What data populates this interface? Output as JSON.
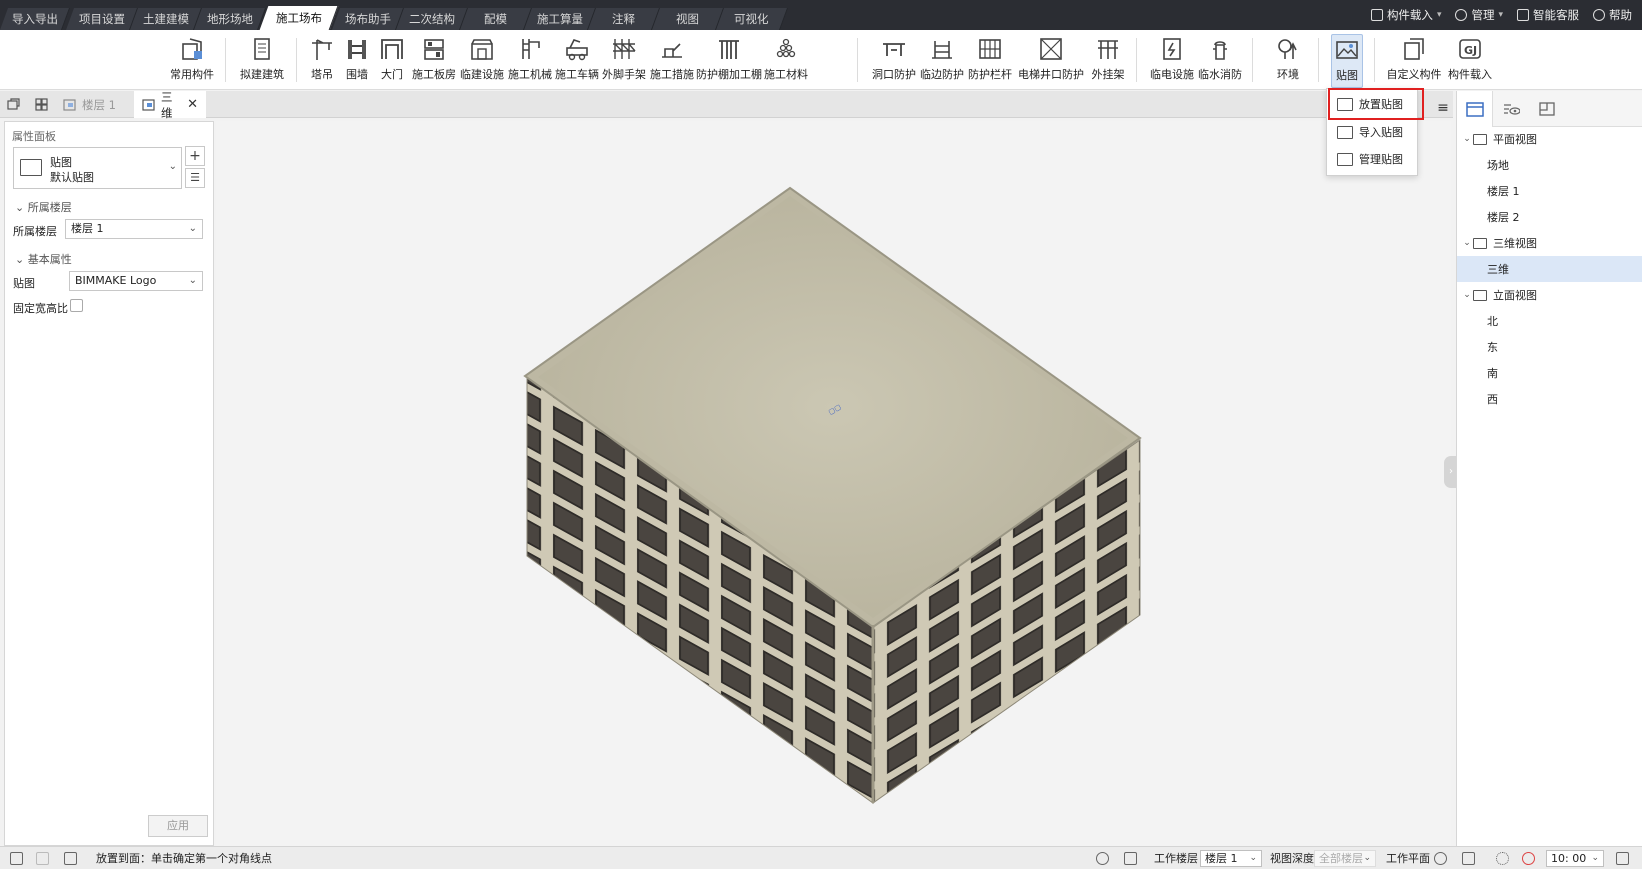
{
  "menu_tabs": [
    {
      "label": "导入导出"
    },
    {
      "label": "项目设置"
    },
    {
      "label": "土建建模"
    },
    {
      "label": "地形场地"
    },
    {
      "label": "施工场布",
      "active": true
    },
    {
      "label": "场布助手"
    },
    {
      "label": "二次结构"
    },
    {
      "label": "配模"
    },
    {
      "label": "施工算量"
    },
    {
      "label": "注释"
    },
    {
      "label": "视图"
    },
    {
      "label": "可视化"
    }
  ],
  "top_right": {
    "component_load": "构件载入",
    "manage": "管理",
    "smart_service": "智能客服",
    "help": "帮助"
  },
  "ribbon": {
    "items": [
      {
        "label": "常用构件",
        "icon": "common-component-icon"
      },
      {
        "label": "拟建建筑",
        "icon": "proposed-building-icon"
      },
      {
        "label": "塔吊",
        "icon": "tower-crane-icon"
      },
      {
        "label": "围墙",
        "icon": "fence-wall-icon"
      },
      {
        "label": "大门",
        "icon": "gate-icon"
      },
      {
        "label": "施工板房",
        "icon": "site-cabin-icon"
      },
      {
        "label": "临建设施",
        "icon": "temporary-facility-icon"
      },
      {
        "label": "施工机械",
        "icon": "construction-machinery-icon"
      },
      {
        "label": "施工车辆",
        "icon": "construction-vehicle-icon"
      },
      {
        "label": "外脚手架",
        "icon": "scaffold-icon"
      },
      {
        "label": "施工措施",
        "icon": "construction-measure-icon"
      },
      {
        "label": "防护棚加工棚",
        "icon": "protective-shed-icon"
      },
      {
        "label": "施工材料",
        "icon": "construction-material-icon"
      },
      {
        "label": "洞口防护",
        "icon": "opening-protection-icon"
      },
      {
        "label": "临边防护",
        "icon": "edge-protection-icon"
      },
      {
        "label": "防护栏杆",
        "icon": "guardrail-icon"
      },
      {
        "label": "电梯井口防护",
        "icon": "elevator-shaft-protection-icon"
      },
      {
        "label": "外挂架",
        "icon": "external-rack-icon"
      },
      {
        "label": "临电设施",
        "icon": "temporary-power-icon"
      },
      {
        "label": "临水消防",
        "icon": "fire-hydrant-icon"
      },
      {
        "label": "环境",
        "icon": "tree-environment-icon"
      },
      {
        "label": "贴图",
        "icon": "decal-icon",
        "selected": true
      },
      {
        "label": "自定义构件",
        "icon": "custom-component-icon"
      },
      {
        "label": "构件载入",
        "icon": "component-load-icon"
      }
    ]
  },
  "decal_menu": {
    "items": [
      {
        "label": "放置贴图",
        "highlighted": true
      },
      {
        "label": "导入贴图"
      },
      {
        "label": "管理贴图"
      }
    ]
  },
  "view_tabs": [
    {
      "label": "楼层 1",
      "active": false
    },
    {
      "label": "三维",
      "active": true
    }
  ],
  "properties": {
    "title": "属性面板",
    "type_name": "贴图",
    "type_sub": "默认贴图",
    "section_floor": "所属楼层",
    "floor_label": "所属楼层",
    "floor_value": "楼层 1",
    "section_basic": "基本属性",
    "decal_label": "贴图",
    "decal_value": "BIMMAKE Logo",
    "fixed_ratio_label": "固定宽高比",
    "fixed_ratio_checked": false,
    "apply": "应用"
  },
  "project_tree": {
    "nodes": [
      {
        "label": "平面视图",
        "level": 0,
        "expanded": true
      },
      {
        "label": "场地",
        "level": 1
      },
      {
        "label": "楼层 1",
        "level": 1
      },
      {
        "label": "楼层 2",
        "level": 1
      },
      {
        "label": "三维视图",
        "level": 0,
        "expanded": true
      },
      {
        "label": "三维",
        "level": 1,
        "selected": true
      },
      {
        "label": "立面视图",
        "level": 0,
        "expanded": true
      },
      {
        "label": "北",
        "level": 1
      },
      {
        "label": "东",
        "level": 1
      },
      {
        "label": "南",
        "level": 1
      },
      {
        "label": "西",
        "level": 1
      }
    ]
  },
  "status": {
    "message": "放置到面：单击确定第一个对角线点",
    "work_floor_label": "工作楼层",
    "work_floor_value": "楼层 1",
    "view_depth_label": "视图深度",
    "view_depth_value": "全部楼层",
    "work_plane_label": "工作平面",
    "time": "10: 00"
  },
  "colors": {
    "tabbar": "#2b2d33",
    "accent_highlight": "#e02020",
    "selected": "#dbe7f7"
  }
}
